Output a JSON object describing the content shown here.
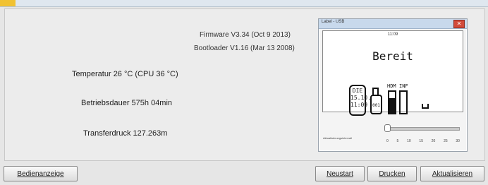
{
  "info": {
    "firmware": "Firmware V3.34 (Oct 9 2013)",
    "bootloader": "Bootloader V1.16 (Mar 13 2008)"
  },
  "stats": {
    "temperature": "Temperatur 26 °C (CPU 36 °C)",
    "runtime": "Betriebsdauer 575h 04min",
    "transfer": "Transferdruck 127.263m"
  },
  "device": {
    "title": "Label - USB",
    "close_glyph": "✕",
    "time": "11:09",
    "status": "Bereit",
    "date_lines": [
      "DIE",
      "15.10.",
      "11:09"
    ],
    "cartridge_label": "001",
    "gauges": [
      {
        "label": "HDM",
        "level": 0.7
      },
      {
        "label": "INF",
        "level": 0.0
      }
    ],
    "slider": {
      "label": "Aktualisierungsintervall",
      "value": 0,
      "ticks": [
        "0",
        "5",
        "10",
        "15",
        "20",
        "25",
        "30"
      ]
    }
  },
  "buttons": {
    "operator_display": "Bedienanzeige",
    "restart": "Neustart",
    "print": "Drucken",
    "refresh": "Aktualisieren"
  }
}
